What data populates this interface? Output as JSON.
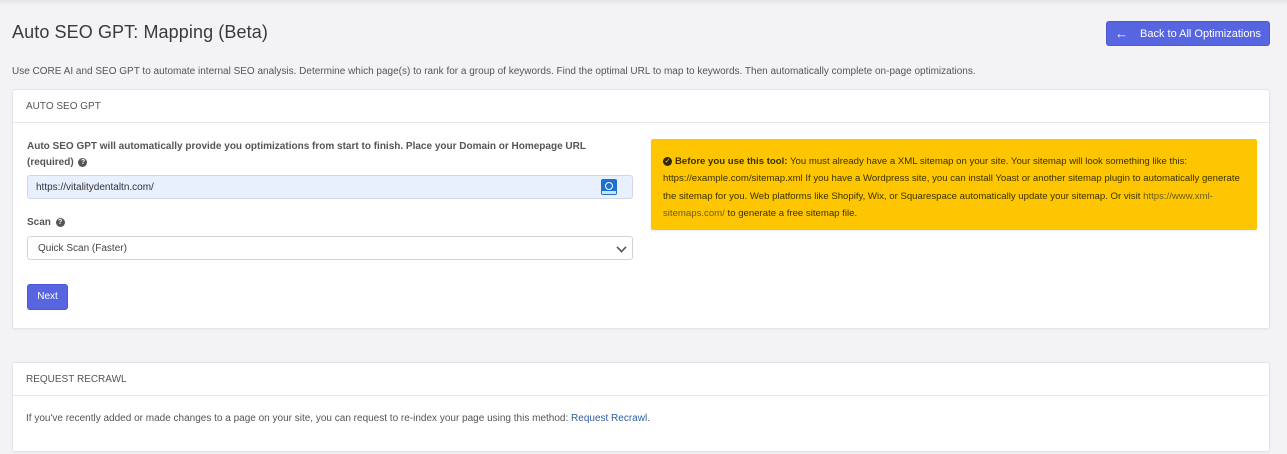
{
  "header": {
    "title": "Auto SEO GPT: Mapping (Beta)",
    "back_button_label": "Back to All Optimizations",
    "back_icon": "arrow-left-icon"
  },
  "description": "Use CORE AI and SEO GPT to automate internal SEO analysis. Determine which page(s) to rank for a group of keywords. Find the optimal URL to map to keywords. Then automatically complete on-page optimizations.",
  "auto_seo_card": {
    "header": "AUTO SEO GPT",
    "url_label": "Auto SEO GPT will automatically provide you optimizations from start to finish. Place your Domain or Homepage URL",
    "url_label_required": "(required)",
    "url_value": "https://vitalitydentaltn.com/",
    "scan_label": "Scan",
    "scan_selected": "Quick Scan (Faster)",
    "next_label": "Next",
    "warning": {
      "bold": "Before you use this tool:",
      "text_part1": " You must already have a XML sitemap on your site. Your sitemap will look something like this: https://example.com/sitemap.xml If you have a Wordpress site, you can install Yoast or another sitemap plugin to automatically generate the sitemap for you. Web platforms like Shopify, Wix, or Squarespace automatically update your sitemap. Or visit ",
      "link": "https://www.xml-sitemaps.com/",
      "text_part2": " to generate a free sitemap file."
    }
  },
  "recrawl_card": {
    "header": "REQUEST RECRAWL",
    "text": "If you've recently added or made changes to a page on your site, you can request to re-index your page using this method: ",
    "link": "Request Recrawl",
    "suffix": "."
  },
  "colors": {
    "primary": "#5765e0",
    "warning": "#fec600",
    "background": "#f3f3f6"
  }
}
